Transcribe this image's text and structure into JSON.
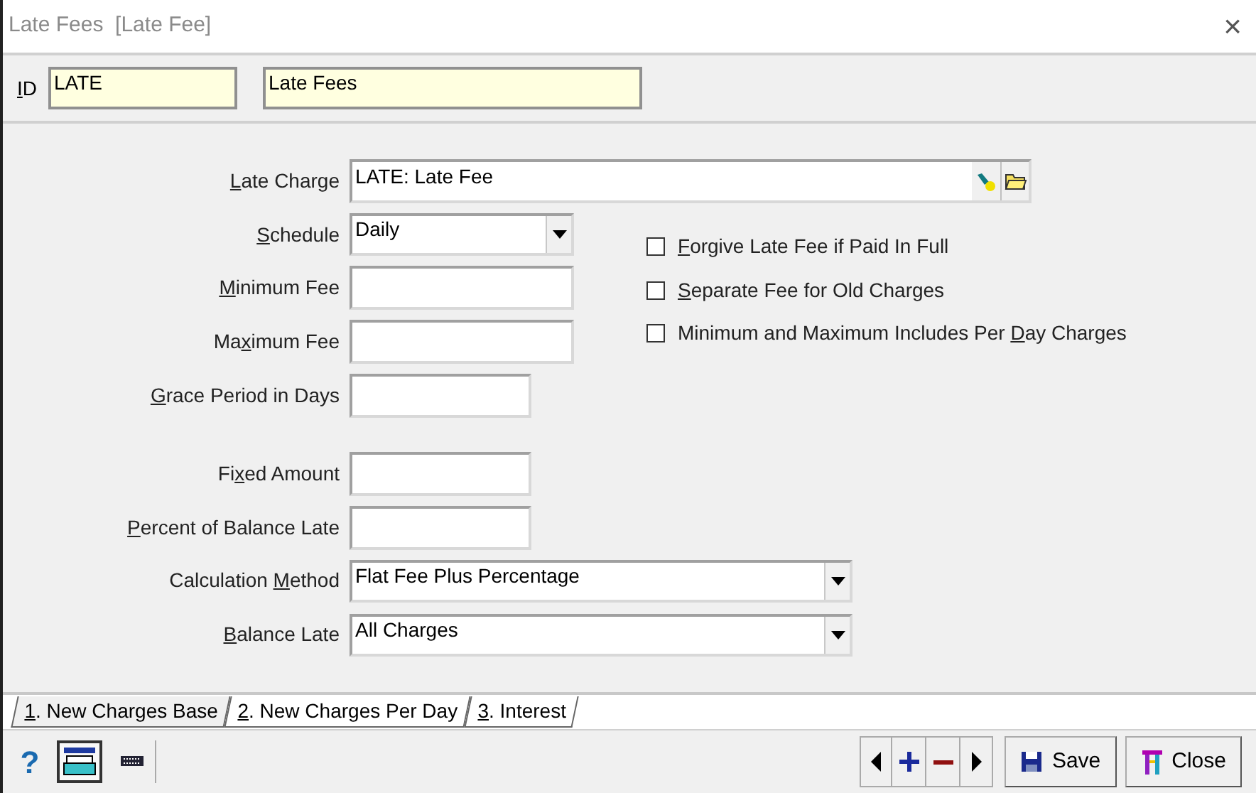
{
  "window": {
    "title": "Late Fees  [Late Fee]",
    "close": "×"
  },
  "id_row": {
    "label": {
      "key": "I",
      "after": "D"
    },
    "code": "LATE",
    "description": "Late Fees"
  },
  "late_charge": {
    "label": {
      "key": "L",
      "after": "ate Charge"
    },
    "kind": "lookup",
    "value": "LATE: Late Fee"
  },
  "fields": [
    {
      "label": {
        "key": "S",
        "after": "chedule"
      },
      "kind": "dropdown",
      "value": "Daily"
    },
    {
      "label": {
        "key": "M",
        "after": "inimum Fee"
      },
      "kind": "text"
    },
    {
      "label": {
        "before": "Ma",
        "key": "x",
        "after": "imum Fee"
      },
      "kind": "text"
    },
    {
      "label": {
        "key": "G",
        "after": "race Period in Days"
      },
      "kind": "text"
    },
    {
      "kind": "spacer"
    },
    {
      "label": {
        "before": "Fi",
        "key": "x",
        "after": "ed Amount"
      },
      "kind": "text"
    },
    {
      "label": {
        "key": "P",
        "after": "ercent of Balance Late"
      },
      "kind": "text"
    },
    {
      "label": {
        "before": "Calculation ",
        "key": "M",
        "after": "ethod"
      },
      "kind": "dropdown",
      "value": "Flat Fee Plus Percentage"
    },
    {
      "label": {
        "key": "B",
        "after": "alance Late"
      },
      "kind": "dropdown",
      "value": "All Charges"
    }
  ],
  "options": [
    {
      "label": {
        "key": "F",
        "after": "orgive Late Fee if Paid In Full"
      },
      "checked": false
    },
    {
      "label": {
        "key": "S",
        "after": "eparate Fee for Old Charges"
      },
      "checked": false
    },
    {
      "label": {
        "before": "Minimum and Maximum Includes Per ",
        "key": "D",
        "after": "ay Charges"
      },
      "checked": false
    }
  ],
  "tabs": [
    {
      "label": {
        "key": "1",
        "after": ". New Charges Base"
      },
      "selected": true
    },
    {
      "label": {
        "key": "2",
        "after": ". New Charges Per Day"
      },
      "selected": false
    },
    {
      "label": {
        "key": "3",
        "after": ". Interest"
      },
      "selected": false
    }
  ],
  "toolbar": {
    "help": "?",
    "print_selected": true,
    "buttons": [
      {
        "kind": "save",
        "label": "Save"
      },
      {
        "kind": "close",
        "label": "Close"
      }
    ]
  }
}
